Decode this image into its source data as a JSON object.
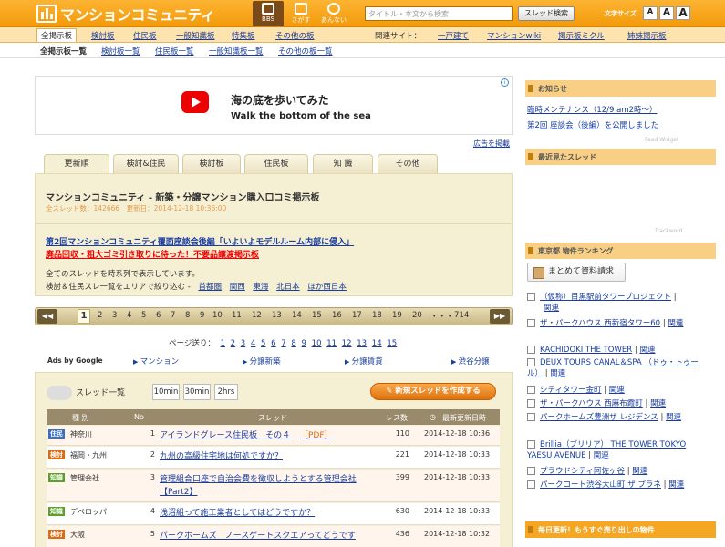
{
  "header": {
    "logo": "マンションコミュニティ",
    "nav": [
      {
        "label": "BBS"
      },
      {
        "label": "さがす"
      },
      {
        "label": "あんない"
      }
    ],
    "search_placeholder": "タイトル・本文から検索",
    "search_button": "スレッド検索",
    "font_size_label": "文字サイズ",
    "font_sizes": [
      "A",
      "A",
      "A"
    ]
  },
  "nav1": {
    "items": [
      "全掲示板",
      "検討板",
      "住民板",
      "一般知識板",
      "特集板",
      "その他の板"
    ],
    "related_label": "関連サイト：",
    "related": [
      "一戸建て",
      "マンションwiki",
      "掲示板ミクル",
      "姉妹掲示板"
    ]
  },
  "nav2": {
    "items": [
      "全掲示板一覧",
      "検討板一覧",
      "住民板一覧",
      "一般知識板一覧",
      "その他の板一覧"
    ]
  },
  "ad": {
    "title_jp": "海の底を歩いてみた",
    "title_en": "Walk the bottom of the sea",
    "info": "i"
  },
  "ad_link": "広告を掲載",
  "tabs": [
    "更新順",
    "検討&住民",
    "検討板",
    "住民板",
    "知 識",
    "その他"
  ],
  "info_box": {
    "title": "マンションコミュニティ - 新築・分譲マンション購入口コミ掲示板",
    "meta": "全スレッド数：142666　更新日：2014-12-18 10:36:00",
    "link1": "第2回マンションコミュニティ覆面座談会後編「いよいよモデルルーム内部に侵入」",
    "link2": "廃品回収・粗大ゴミ引き取りに待った！不要品譲渡掲示板",
    "text1": "全てのスレッドを時系列で表示しています。",
    "text2": "検討＆住民スレ一覧をエリアで絞り込む -",
    "areas": [
      "首都圏",
      "関西",
      "東海",
      "北日本",
      "ほか西日本"
    ]
  },
  "pager": {
    "prev": "◀◀",
    "next": "▶▶",
    "pages": [
      "1",
      "2",
      "3",
      "4",
      "5",
      "6",
      "7",
      "8",
      "9",
      "10",
      "11",
      "12",
      "13",
      "14",
      "15",
      "16",
      "17",
      "18",
      "19",
      "20",
      "・・・",
      "714"
    ]
  },
  "page_send": {
    "label": "ページ送り：",
    "pages": [
      "1",
      "2",
      "3",
      "4",
      "5",
      "6",
      "7",
      "8",
      "9",
      "10",
      "11",
      "12",
      "13",
      "14",
      "15"
    ]
  },
  "ads_by_google": {
    "label": "Ads by Google",
    "links": [
      "マンション",
      "分譲新築",
      "分譲賃貸",
      "渋谷分譲"
    ]
  },
  "thread_list": {
    "title": "スレッド一覧",
    "time_filters": [
      "10min",
      "30min",
      "2hrs"
    ],
    "new_thread": "新規スレッドを作成する",
    "headers": {
      "type": "種 別",
      "no": "No",
      "thread": "スレッド",
      "count": "レス数",
      "updated": "最新更新日時"
    },
    "rows": [
      {
        "badge": "住民",
        "badge_color": "#3a6fc2",
        "area": "神奈川",
        "no": "1",
        "title": "アイランドグレース住民板　その４",
        "extra": "［PDF］",
        "count": "110",
        "date": "2014-12-18 10:36"
      },
      {
        "badge": "検討",
        "badge_color": "#e06a10",
        "area": "福岡・九州",
        "no": "2",
        "title": "九州の高級住宅地は何処ですか？",
        "extra": "",
        "count": "221",
        "date": "2014-12-18 10:33"
      },
      {
        "badge": "知識",
        "badge_color": "#5ca02a",
        "area": "管理会社",
        "no": "3",
        "title": "管理組合口座で自治会費を徴収しようとする管理会社【Part2】",
        "extra": "",
        "count": "399",
        "date": "2014-12-18 10:33"
      },
      {
        "badge": "知識",
        "badge_color": "#5ca02a",
        "area": "デベロッパ",
        "no": "4",
        "title": "浅沼組って施工業者としてはどうですか？",
        "extra": "",
        "count": "630",
        "date": "2014-12-18 10:33"
      },
      {
        "badge": "検討",
        "badge_color": "#e06a10",
        "area": "大阪",
        "no": "5",
        "title": "パークホームズ　ノースゲートスクエアってどうです",
        "extra": "",
        "count": "436",
        "date": "2014-12-18 10:32"
      }
    ]
  },
  "sidebar": {
    "news_title": "お知らせ",
    "news": [
      "臨時メンテナンス（12/9 am2時〜）",
      "第2回 座談会（後編）を公開しました"
    ],
    "feed_widget": "Feed Widget",
    "recent_title": "最近見たスレッド",
    "trackword": "Trackword",
    "ranking_title": "東京都 物件ランキング",
    "matome_button": "まとめて資料請求",
    "related_word": "関連",
    "ranking": [
      "（仮称）目黒駅前タワープロジェクト",
      "ザ・パークハウス 西新宿タワー60",
      "KACHIDOKI THE TOWER",
      "DEUX TOURS CANAL＆SPA （ドゥ・トゥール）",
      "シティタワー金町",
      "ザ・パークハウス 西麻布霞町",
      "パークホームズ豊洲ザ レジデンス",
      "Brillia（ブリリア） THE TOWER TOKYO YAESU AVENUE",
      "プラウドシティ阿佐ヶ谷",
      "パークコート渋谷大山町 ザ プラネ"
    ],
    "bottom_title": "毎日更新！もうすぐ売り出しの物件"
  }
}
